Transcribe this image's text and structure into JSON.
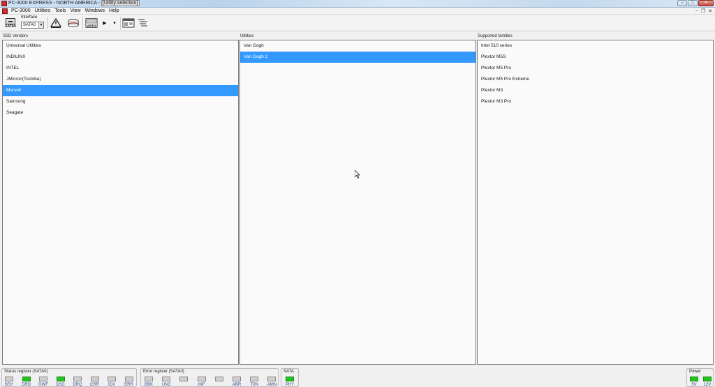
{
  "window": {
    "title_prefix": "PC-3000 EXPRESS - NORTH AMERICA - ",
    "title_selected": "[Utility selection]",
    "minimize": "–",
    "maximize": "□",
    "close": "✕"
  },
  "menu": {
    "items": [
      "PC-3000",
      "Utilities",
      "Tools",
      "View",
      "Windows",
      "Help"
    ],
    "mdi_minimize": "–",
    "mdi_restore": "❐",
    "mdi_close": "✕"
  },
  "toolbar": {
    "sata_label": "SATA0",
    "interface_label": "Interface",
    "interface_value": "SATA0",
    "interface_arrow": "▼",
    "arto_label": "ARTO",
    "play_arrow": "▶",
    "dropdown_arrow": "▾"
  },
  "panels": {
    "vendors": {
      "label": "SSD Vendors",
      "items": [
        "Universal Utilities",
        "INDILINX",
        "INTEL",
        "JMicron(Toshiba)",
        "Marvell",
        "Samsung",
        "Seagate"
      ],
      "selected": "Marvell"
    },
    "utilities": {
      "label": "Utilities",
      "items": [
        "Van Gogh",
        "Van Gogh 2"
      ],
      "selected": "Van Gogh 2"
    },
    "families": {
      "label": "Supported families",
      "items": [
        "Intel 510 series",
        "Plextor M5S",
        "Plextor M5 Pro",
        "Plextor M5 Pro Extreme",
        "Plextor M3",
        "Plextor M3 Pro"
      ]
    }
  },
  "status": {
    "status_register": {
      "title": "Status register (SATA0)",
      "leds": [
        {
          "label": "BSY",
          "on": false
        },
        {
          "label": "DRD",
          "on": true
        },
        {
          "label": "DWF",
          "on": false
        },
        {
          "label": "DSC",
          "on": true
        },
        {
          "label": "DRQ",
          "on": false
        },
        {
          "label": "CRR",
          "on": false
        },
        {
          "label": "IDX",
          "on": false
        },
        {
          "label": "ERR",
          "on": false
        }
      ]
    },
    "error_register": {
      "title": "Error register (SATA0)",
      "leds": [
        {
          "label": "BBK",
          "on": false
        },
        {
          "label": "UNC",
          "on": false
        },
        {
          "label": "",
          "on": false
        },
        {
          "label": "INF",
          "on": false
        },
        {
          "label": "",
          "on": false
        },
        {
          "label": "ABR",
          "on": false
        },
        {
          "label": "T0N",
          "on": false
        },
        {
          "label": "AMN",
          "on": false
        }
      ]
    },
    "sata": {
      "title": "SATA",
      "leds": [
        {
          "label": "PHY",
          "on": true
        }
      ]
    },
    "power": {
      "title": "Power",
      "leds": [
        {
          "label": "5V",
          "on": true
        },
        {
          "label": "12V",
          "on": true
        }
      ]
    }
  },
  "colors": {
    "selection": "#3399ff",
    "led_on": "#22c41f",
    "led_off": "#cfcfcf"
  }
}
